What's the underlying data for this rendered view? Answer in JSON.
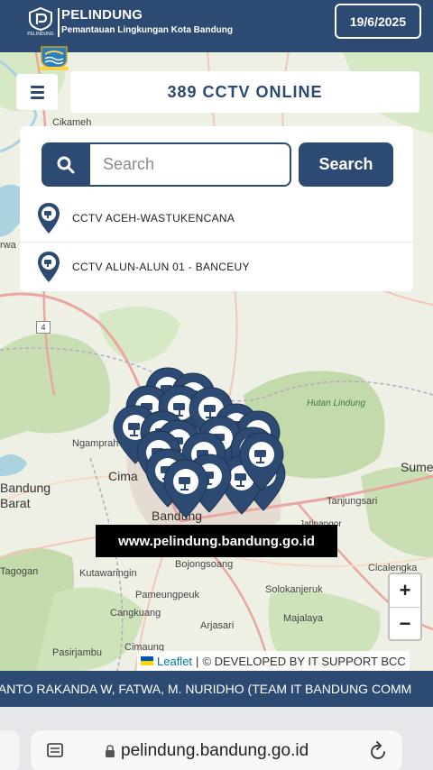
{
  "header": {
    "logo_caption": "PELINDUNG",
    "title": "PELINDUNG",
    "subtitle": "Pemantauan Lingkungan Kota Bandung",
    "date": "19/6/2025"
  },
  "status": {
    "text": "389 CCTV ONLINE"
  },
  "search": {
    "placeholder": "Search",
    "value": "",
    "button_label": "Search"
  },
  "results": [
    {
      "label": "CCTV ACEH-WASTUKENCANA"
    },
    {
      "label": "CCTV ALUN-ALUN 01 - BANCEUY"
    }
  ],
  "map": {
    "labels": {
      "cikameh": "Cikameh",
      "rwa": "rwa",
      "ngamprah": "Ngamprah",
      "cima": "Cima",
      "bandung_barat": "Bandung\nBarat",
      "bandung": "Bandung",
      "hutan_lindung": "Hutan Lindung",
      "sume": "Sume",
      "tanjungsari": "Tanjungsari",
      "tagogan": "Tagogan",
      "kutawaringin": "Kutawaringin",
      "bojongsoang": "Bojongsoang",
      "cicalengka": "Cicalengka",
      "pameungpeuk": "Pameungpeuk",
      "solokanjeruk": "Solokanjeruk",
      "cangkuang": "Cangkuang",
      "majalaya": "Majalaya",
      "arjasari": "Arjasari",
      "pasirjambu": "Pasirjambu",
      "cimaung": "Cimaung",
      "jatinangor": "Jatinangor",
      "road_number": "4"
    },
    "url_overlay": "www.pelindung.bandung.go.id",
    "zoom_in": "+",
    "zoom_out": "−",
    "attribution": {
      "leaflet": "Leaflet",
      "separator": "|",
      "developer": "© DEVELOPED BY IT SUPPORT BCC"
    },
    "marker_count_visible": 14
  },
  "ticker": {
    "text": "IANTO RAKANDA W, FATWA, M. NURIDHO (TEAM IT BANDUNG COMM"
  },
  "browser": {
    "url": "pelindung.bandung.go.id"
  },
  "colors": {
    "primary": "#2c4a72",
    "forest": "#c7ddb0",
    "water": "#aad3df"
  }
}
